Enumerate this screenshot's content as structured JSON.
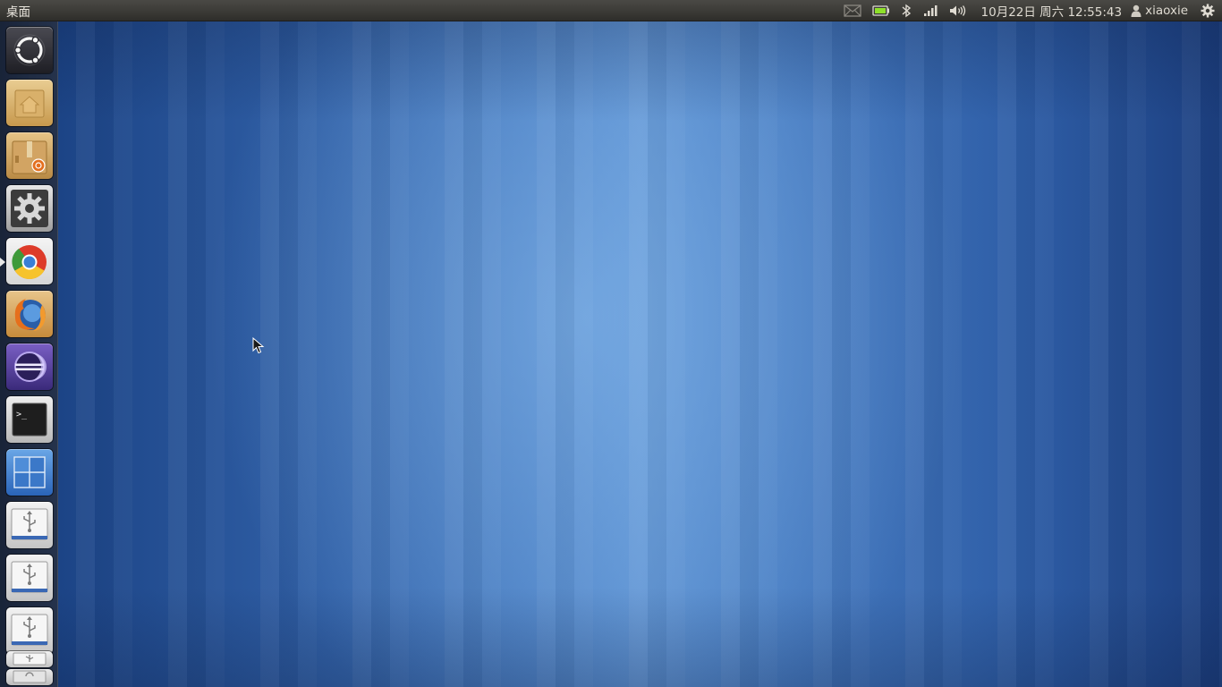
{
  "panel": {
    "title": "桌面",
    "clock": "10月22日 周六 12:55:43",
    "user": "xiaoxie",
    "indicators": [
      "mail-icon",
      "battery-icon",
      "bluetooth-icon",
      "network-signal-icon",
      "volume-icon",
      "gear-icon"
    ]
  },
  "launcher": {
    "items": [
      {
        "name": "dash-home",
        "icon": "ubuntu-logo-icon"
      },
      {
        "name": "home-folder",
        "icon": "home-folder-icon"
      },
      {
        "name": "software-center",
        "icon": "software-center-icon"
      },
      {
        "name": "system-settings",
        "icon": "gear-icon"
      },
      {
        "name": "chrome",
        "icon": "chrome-icon",
        "active": true
      },
      {
        "name": "firefox",
        "icon": "firefox-icon"
      },
      {
        "name": "eclipse",
        "icon": "eclipse-icon"
      },
      {
        "name": "terminal",
        "icon": "terminal-icon",
        "text": ">_"
      },
      {
        "name": "workspace-switcher",
        "icon": "workspace-switcher-icon"
      },
      {
        "name": "usb-drive-1",
        "icon": "usb-drive-icon"
      },
      {
        "name": "usb-drive-2",
        "icon": "usb-drive-icon"
      },
      {
        "name": "usb-drive-3",
        "icon": "usb-drive-icon"
      },
      {
        "name": "usb-drive-4",
        "icon": "usb-drive-icon"
      },
      {
        "name": "trash",
        "icon": "trash-icon"
      }
    ]
  }
}
